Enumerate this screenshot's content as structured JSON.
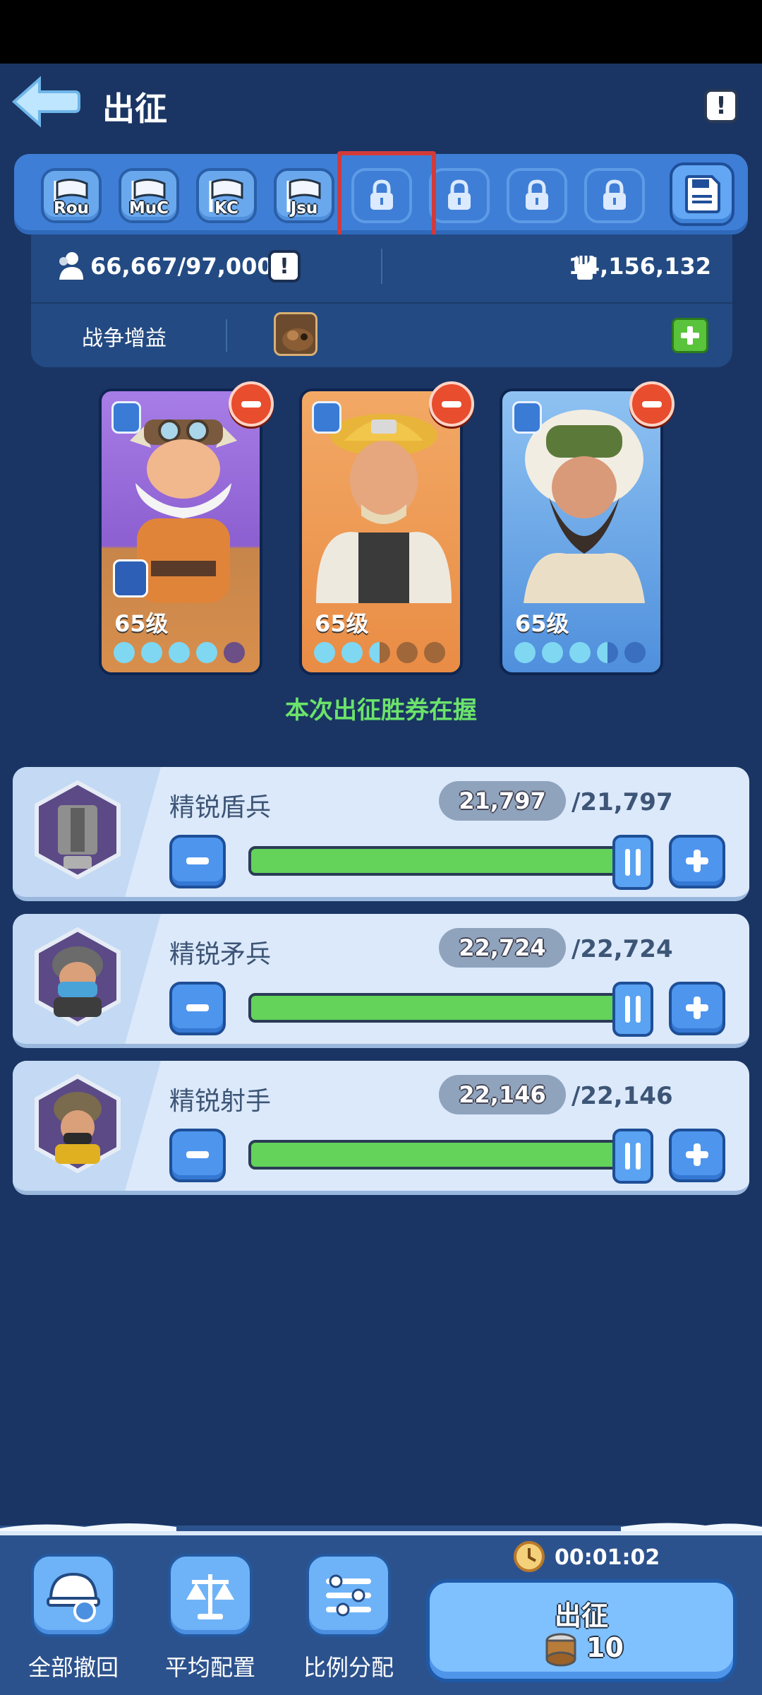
{
  "header": {
    "title": "出征"
  },
  "presets": [
    {
      "label": "Rou",
      "locked": false
    },
    {
      "label": "MuC",
      "locked": false
    },
    {
      "label": "KC",
      "locked": false
    },
    {
      "label": "Jsu",
      "locked": false
    },
    {
      "label": "",
      "locked": true
    },
    {
      "label": "",
      "locked": true
    },
    {
      "label": "",
      "locked": true
    },
    {
      "label": "",
      "locked": true
    }
  ],
  "stats": {
    "troops": "66,667/97,000",
    "power": "14,156,132",
    "buff_label": "战争增益"
  },
  "heroes": [
    {
      "level": "65级",
      "stars": 4,
      "class_icon": "pickaxe-icon"
    },
    {
      "level": "65级",
      "stars": 2.5,
      "class_icon": "crossbow-icon"
    },
    {
      "level": "65级",
      "stars": 3.5,
      "class_icon": "shield-icon"
    }
  ],
  "victory_text": "本次出征胜券在握",
  "troops": [
    {
      "name": "精锐盾兵",
      "count": "21,797",
      "max": "/21,797",
      "fill_fraction": 1.0
    },
    {
      "name": "精锐矛兵",
      "count": "22,724",
      "max": "/22,724",
      "fill_fraction": 1.0
    },
    {
      "name": "精锐射手",
      "count": "22,146",
      "max": "/22,146",
      "fill_fraction": 1.0
    }
  ],
  "actions": {
    "recall_all": "全部撤回",
    "balance": "平均配置",
    "ratio": "比例分配"
  },
  "march": {
    "label": "出征",
    "cost": "10",
    "timer": "00:01:02"
  },
  "colors": {
    "accent": "#3f7ed6",
    "background": "#1a3563",
    "victory": "#6be36a",
    "remove": "#e84d2e"
  }
}
